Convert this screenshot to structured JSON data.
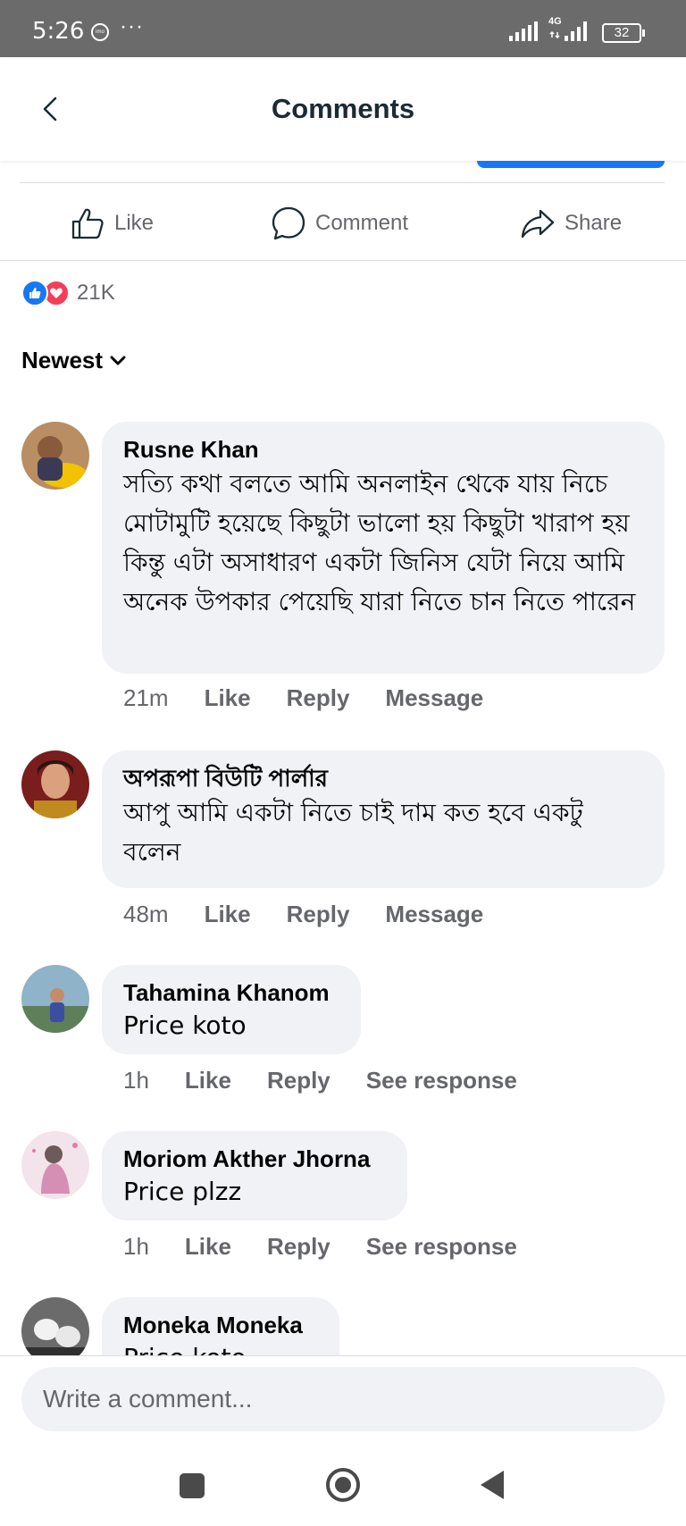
{
  "status_bar": {
    "time": "5:26",
    "dots": "···",
    "network": "4G",
    "battery": "32"
  },
  "header": {
    "title": "Comments"
  },
  "actions": {
    "like": "Like",
    "comment": "Comment",
    "share": "Share"
  },
  "reactions": {
    "count": "21K"
  },
  "sort": {
    "label": "Newest"
  },
  "comments": [
    {
      "name": "Rusne Khan",
      "text": "সত্যি কথা বলতে আমি অনলাইন থেকে যায় নিচে মোটামুটি হয়েছে কিছুটা ভালো হয় কিছুটা খারাপ হয় কিন্তু এটা অসাধারণ একটা জিনিস যেটা নিয়ে আমি অনেক উপকার পেয়েছি যারা নিতে চান নিতে পারেন",
      "time": "21m",
      "like": "Like",
      "reply": "Reply",
      "extra": "Message"
    },
    {
      "name": "অপরূপা বিউটি পার্লার",
      "text": "আপু আমি একটা নিতে চাই দাম কত হবে একটু বলেন",
      "time": "48m",
      "like": "Like",
      "reply": "Reply",
      "extra": "Message"
    },
    {
      "name": "Tahamina Khanom",
      "text": "Price koto",
      "time": "1h",
      "like": "Like",
      "reply": "Reply",
      "extra": "See response"
    },
    {
      "name": "Moriom Akther Jhorna",
      "text": "Price plzz",
      "time": "1h",
      "like": "Like",
      "reply": "Reply",
      "extra": "See response"
    },
    {
      "name": "Moneka Moneka",
      "text": "Price koto"
    }
  ],
  "composer": {
    "placeholder": "Write a comment..."
  }
}
